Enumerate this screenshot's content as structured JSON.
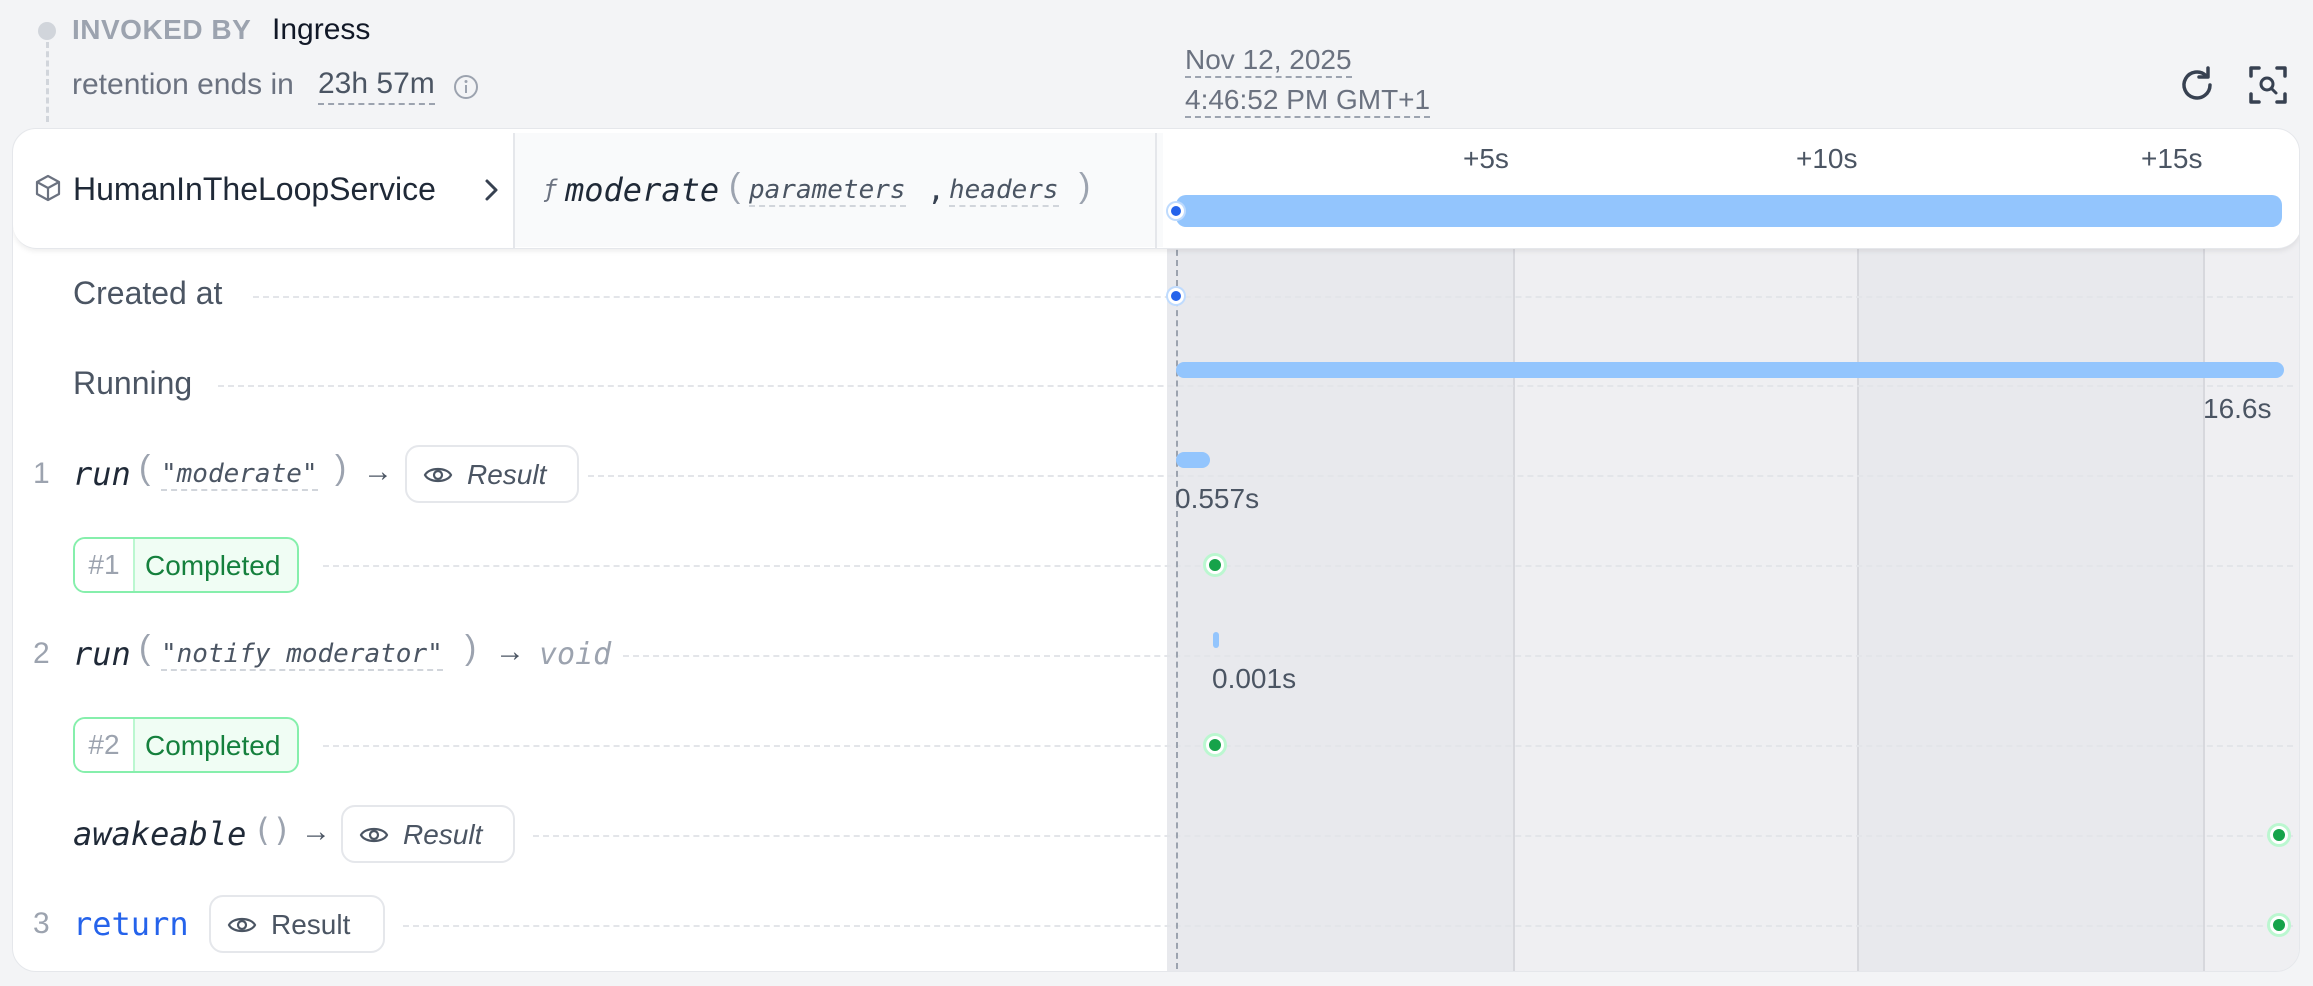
{
  "header": {
    "invoked_by_label": "INVOKED BY",
    "invoked_by_value": "Ingress",
    "retention_label": "retention ends in",
    "retention_value": "23h 57m",
    "date": "Nov 12, 2025",
    "time": "4:46:52 PM GMT+1"
  },
  "invocation": {
    "service": "HumanInTheLoopService",
    "function_icon": "ƒ",
    "function": "moderate",
    "params": [
      "parameters",
      "headers"
    ],
    "separator": ","
  },
  "timeline": {
    "ticks": [
      "+5s",
      "+10s",
      "+15s"
    ],
    "total_seconds": 16.6
  },
  "rows": {
    "created_label": "Created at",
    "running_label": "Running",
    "running_duration": "16.6s",
    "step1": {
      "num": "1",
      "keyword": "run",
      "arg": "\"moderate\"",
      "arrow": "→",
      "result": "Result",
      "duration": "0.557s",
      "duration_seconds": 0.557
    },
    "attempt1": {
      "num": "#1",
      "status": "Completed"
    },
    "step2": {
      "num": "2",
      "keyword": "run",
      "arg": "\"notify moderator\"",
      "arrow": "→",
      "ret": "void",
      "duration": "0.001s",
      "duration_seconds": 0.001
    },
    "attempt2": {
      "num": "#2",
      "status": "Completed"
    },
    "awakeable": {
      "keyword": "awakeable",
      "parens": "()",
      "arrow": "→",
      "result": "Result"
    },
    "ret": {
      "num": "3",
      "keyword": "return",
      "result": "Result"
    }
  },
  "colors": {
    "accent": "#2563eb",
    "bar": "#93c5fd",
    "success": "#16a34a"
  }
}
